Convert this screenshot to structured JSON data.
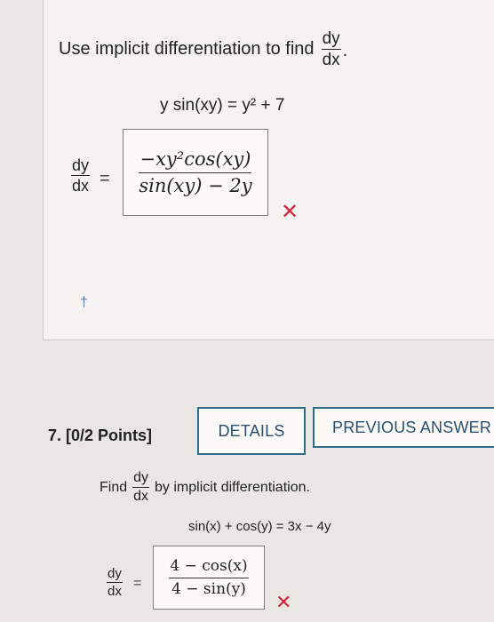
{
  "question_prev": {
    "prompt_text": "Use implicit differentiation to find",
    "prompt_fraction": {
      "numerator": "dy",
      "denominator": "dx"
    },
    "prompt_period": ".",
    "equation": "y sin(xy) = y² + 7",
    "answer_label": {
      "numerator": "dy",
      "denominator": "dx"
    },
    "equals": "=",
    "answer": {
      "numerator": "−xy²cos(xy)",
      "denominator": "sin(xy) − 2y"
    },
    "result_mark": "✕",
    "dagger": "†"
  },
  "question_7": {
    "header": "7. [0/2 Points]",
    "details_label": "DETAILS",
    "previous_answers_label": "PREVIOUS ANSWER",
    "find_prefix": "Find",
    "find_fraction": {
      "numerator": "dy",
      "denominator": "dx"
    },
    "find_suffix": "by implicit differentiation.",
    "equation": "sin(x) + cos(y) = 3x − 4y",
    "answer_label": {
      "numerator": "dy",
      "denominator": "dx"
    },
    "equals": "=",
    "answer": {
      "numerator": "4 − cos(x)",
      "denominator": "4 − sin(y)"
    },
    "result_mark": "✕"
  },
  "colors": {
    "button_border": "#2f6d86",
    "button_text": "#2d4f6e",
    "incorrect_mark": "#d0283a",
    "background": "#e9e7e4"
  }
}
